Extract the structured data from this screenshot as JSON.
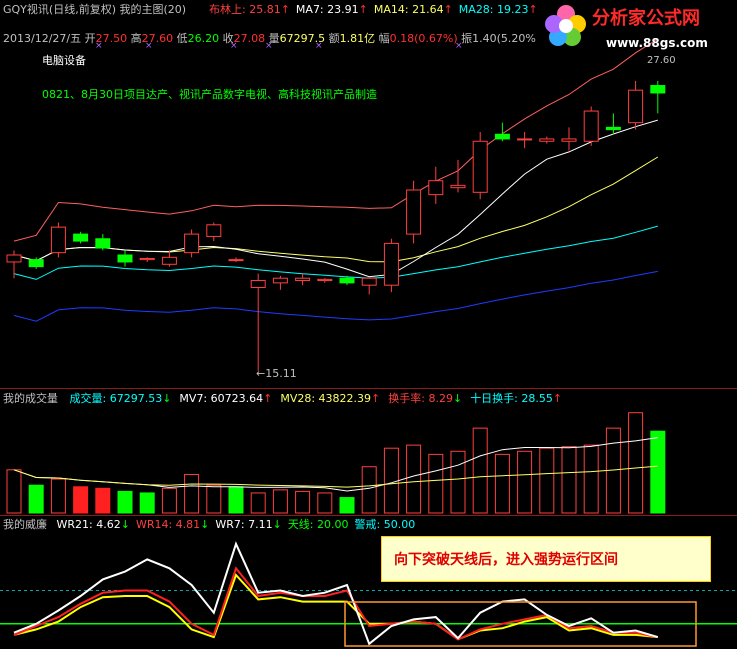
{
  "header": {
    "title": "GQY视讯(日线,前复权) 我的主图(20)",
    "indicators": [
      {
        "label": "布林上: 25.81",
        "arrow": "↑",
        "color": "#ff4040"
      },
      {
        "label": "MA7: 23.91",
        "arrow": "↑",
        "color": "#ffffff"
      },
      {
        "label": "MA14: 21.64",
        "arrow": "↑",
        "color": "#ffff66"
      },
      {
        "label": "MA28: 19.23",
        "arrow": "↑",
        "color": "#00ffff"
      }
    ]
  },
  "info_row": {
    "date": "2013/12/27/五",
    "open_label": "开",
    "open": "27.50",
    "high_label": "高",
    "high": "27.60",
    "low_label": "低",
    "low": "26.20",
    "close_label": "收",
    "close": "27.08",
    "vol_label": "量",
    "vol": "67297.5",
    "amt_label": "额",
    "amt": "1.81亿",
    "chg_label": "幅",
    "chg": "0.18(0.67%)",
    "amp_label": "振",
    "amp": "1.40(5.20%"
  },
  "sector": "电脑设备",
  "news": "0821、8月30日项目达产、视讯产品数字电视、高科技视讯产品制造",
  "low_marker": "←15.11",
  "high_marker": "27.60",
  "volume_panel": {
    "title": "我的成交量",
    "items": [
      {
        "label": "成交量: 67297.53",
        "arrow": "↓",
        "color": "#00ffff"
      },
      {
        "label": "MV7: 60723.64",
        "arrow": "↑",
        "color": "#ffffff"
      },
      {
        "label": "MV28: 43822.39",
        "arrow": "↑",
        "color": "#ffff66"
      },
      {
        "label": "换手率: 8.29",
        "arrow": "↓",
        "color": "#ff4040"
      },
      {
        "label": "十日换手: 28.55",
        "arrow": "↑",
        "color": "#00ffff"
      }
    ]
  },
  "wr_panel": {
    "title": "我的威廉",
    "items": [
      {
        "label": "WR21: 4.62",
        "arrow": "↓",
        "color": "#ffffff"
      },
      {
        "label": "WR14: 4.81",
        "arrow": "↓",
        "color": "#ff4040"
      },
      {
        "label": "WR7: 7.11",
        "arrow": "↓",
        "color": "#ffffff"
      },
      {
        "label": "天线: 20.00",
        "arrow": "",
        "color": "#00ff00"
      },
      {
        "label": "警戒: 50.00",
        "arrow": "",
        "color": "#00ffff"
      }
    ]
  },
  "callout": "向下突破天线后，进入强势运行区间",
  "logo": {
    "name": "分析家公式网",
    "url": "www.88gs.com"
  },
  "colors": {
    "up": "#ff3030",
    "down": "#00ff00",
    "bull_outline": "#ff4040",
    "ma7": "#ffffff",
    "ma14": "#ffff66",
    "ma28": "#00ffff",
    "ma60": "#1e3cff",
    "boll": "#ff6060"
  },
  "chart_data": {
    "type": "candlestick",
    "candles": [
      {
        "o": 19.8,
        "h": 20.3,
        "l": 19.1,
        "c": 20.1
      },
      {
        "o": 19.9,
        "h": 20.0,
        "l": 19.5,
        "c": 19.6
      },
      {
        "o": 20.2,
        "h": 21.5,
        "l": 20.0,
        "c": 21.3
      },
      {
        "o": 21.0,
        "h": 21.1,
        "l": 20.6,
        "c": 20.7
      },
      {
        "o": 20.8,
        "h": 21.0,
        "l": 20.3,
        "c": 20.4
      },
      {
        "o": 20.1,
        "h": 20.3,
        "l": 19.6,
        "c": 19.8
      },
      {
        "o": 19.9,
        "h": 20.0,
        "l": 19.8,
        "c": 19.95
      },
      {
        "o": 19.7,
        "h": 20.3,
        "l": 19.6,
        "c": 20.0
      },
      {
        "o": 20.2,
        "h": 21.2,
        "l": 20.0,
        "c": 21.0
      },
      {
        "o": 20.9,
        "h": 21.5,
        "l": 20.7,
        "c": 21.4
      },
      {
        "o": 19.9,
        "h": 20.0,
        "l": 19.8,
        "c": 19.9
      },
      {
        "o": 18.7,
        "h": 19.3,
        "l": 15.11,
        "c": 19.0
      },
      {
        "o": 18.9,
        "h": 19.2,
        "l": 18.6,
        "c": 19.1
      },
      {
        "o": 19.0,
        "h": 19.3,
        "l": 18.8,
        "c": 19.1
      },
      {
        "o": 19.0,
        "h": 19.1,
        "l": 18.9,
        "c": 19.05
      },
      {
        "o": 19.1,
        "h": 19.2,
        "l": 18.8,
        "c": 18.9
      },
      {
        "o": 18.8,
        "h": 19.1,
        "l": 18.4,
        "c": 19.1
      },
      {
        "o": 18.8,
        "h": 20.8,
        "l": 18.5,
        "c": 20.6
      },
      {
        "o": 21.0,
        "h": 23.3,
        "l": 20.6,
        "c": 22.9
      },
      {
        "o": 22.7,
        "h": 23.9,
        "l": 22.3,
        "c": 23.3
      },
      {
        "o": 23.0,
        "h": 24.2,
        "l": 22.8,
        "c": 23.1
      },
      {
        "o": 22.8,
        "h": 25.4,
        "l": 22.5,
        "c": 25.0
      },
      {
        "o": 25.3,
        "h": 25.8,
        "l": 25.0,
        "c": 25.1
      },
      {
        "o": 25.1,
        "h": 25.4,
        "l": 24.7,
        "c": 25.1
      },
      {
        "o": 25.0,
        "h": 25.2,
        "l": 24.9,
        "c": 25.1
      },
      {
        "o": 25.0,
        "h": 25.6,
        "l": 24.6,
        "c": 25.1
      },
      {
        "o": 25.0,
        "h": 26.5,
        "l": 24.8,
        "c": 26.3
      },
      {
        "o": 25.6,
        "h": 26.2,
        "l": 25.3,
        "c": 25.5
      },
      {
        "o": 25.8,
        "h": 27.6,
        "l": 25.5,
        "c": 27.2
      },
      {
        "o": 27.4,
        "h": 27.6,
        "l": 26.2,
        "c": 27.08
      }
    ],
    "ylim": [
      14.5,
      28.5
    ],
    "volume": {
      "values": [
        28,
        18,
        22,
        17,
        16,
        14,
        13,
        16,
        25,
        18,
        17,
        13,
        15,
        14,
        13,
        10,
        30,
        42,
        44,
        38,
        40,
        55,
        38,
        40,
        42,
        43,
        44,
        55,
        65,
        53
      ],
      "down_idx": [
        1,
        3,
        4,
        5,
        6,
        10,
        15
      ],
      "red_filled_idx": [
        3,
        4
      ],
      "ylim": [
        0,
        70
      ]
    },
    "wr": {
      "wr21": [
        88,
        80,
        68,
        55,
        40,
        33,
        22,
        30,
        45,
        70,
        8,
        52,
        50,
        55,
        52,
        45,
        98,
        82,
        76,
        74,
        93,
        70,
        60,
        58,
        72,
        82,
        75,
        88,
        86,
        92
      ],
      "wr14": [
        90,
        82,
        74,
        62,
        52,
        50,
        50,
        60,
        80,
        90,
        30,
        55,
        52,
        55,
        55,
        50,
        82,
        80,
        78,
        80,
        94,
        85,
        80,
        76,
        72,
        84,
        82,
        88,
        88,
        92
      ],
      "wr7": [
        90,
        85,
        78,
        65,
        56,
        55,
        55,
        65,
        85,
        92,
        36,
        58,
        56,
        60,
        60,
        60,
        80,
        80,
        78,
        80,
        94,
        86,
        84,
        78,
        74,
        86,
        84,
        90,
        90,
        92
      ],
      "antenna": 80,
      "warning": 50,
      "ylim": [
        100,
        0
      ]
    }
  }
}
